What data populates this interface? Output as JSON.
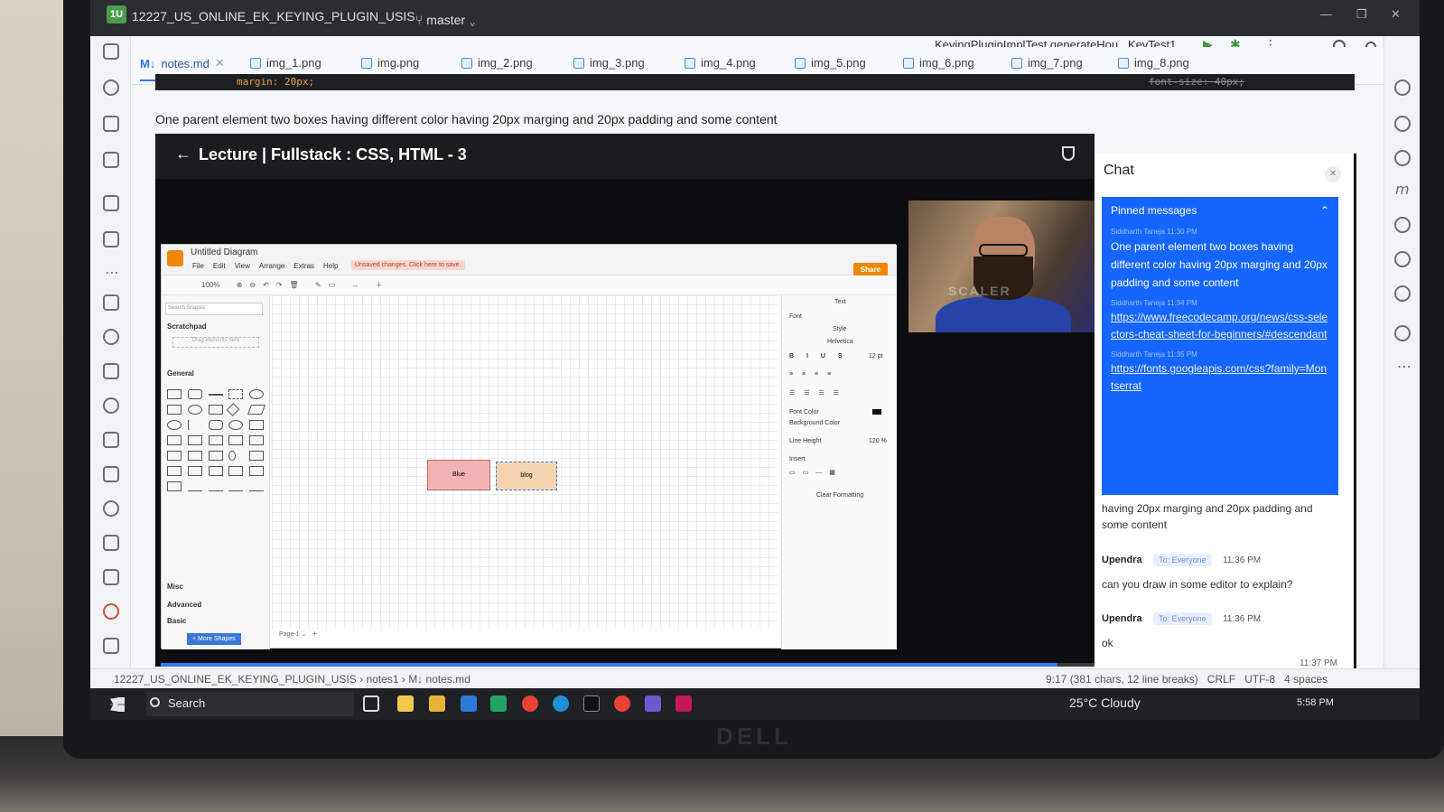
{
  "ide": {
    "project_badge": "1U",
    "project_name": "12227_US_ONLINE_EK_KEYING_PLUGIN_USIS",
    "branch": "master",
    "run_config": "KeyingPluginImplTest.generateHou...KeyTest1",
    "tabs": [
      {
        "label": "notes.md",
        "active": true,
        "prefix": "M↓"
      },
      {
        "label": "img_1.png"
      },
      {
        "label": "img.png"
      },
      {
        "label": "img_2.png"
      },
      {
        "label": "img_3.png"
      },
      {
        "label": "img_4.png"
      },
      {
        "label": "img_5.png"
      },
      {
        "label": "img_6.png"
      },
      {
        "label": "img_7.png"
      },
      {
        "label": "img_8.png"
      }
    ],
    "code_line": "margin: 20px;",
    "code_right": "font-size: 40px;",
    "notes_text": "One parent element two boxes having different color having 20px marging and 20px padding and some content",
    "status": {
      "path_root": "12227_US_ONLINE_EK_KEYING_PLUGIN_USIS",
      "path_folder": "notes1",
      "path_file": "M↓ notes.md",
      "position": "9:17 (381 chars, 12 line breaks)",
      "line_sep": "CRLF",
      "encoding": "UTF-8",
      "indent": "4 spaces"
    }
  },
  "lecture": {
    "title": "Lecture | Fullstack : CSS, HTML - 3",
    "progress": 0.96,
    "webcam_watermark": "SCALER"
  },
  "drawio": {
    "title": "Untitled Diagram",
    "menu": [
      "File",
      "Edit",
      "View",
      "Arrange",
      "Extras",
      "Help"
    ],
    "unsaved": "Unsaved changes. Click here to save.",
    "share": "Share",
    "zoom": "100%",
    "search_placeholder": "Search Shapes",
    "sections": [
      "Scratchpad",
      "General",
      "Misc",
      "Advanced",
      "Basic"
    ],
    "scratch_hint": "Drag elements here",
    "more_shapes": "+ More Shapes",
    "page": "Page-1",
    "box1": "Blue",
    "box2": "blog",
    "panel": {
      "tab": "Text",
      "font": "Font",
      "style": "Style",
      "font_name": "Helvetica",
      "font_size": "12 pt",
      "font_color": "Font Color",
      "bg_color": "Background Color",
      "line_height": "Line Height",
      "line_height_val": "120 %",
      "insert": "Insert",
      "clear": "Clear Formatting"
    }
  },
  "chat": {
    "title": "Chat",
    "pinned_header": "Pinned messages",
    "pinned": [
      {
        "meta": "Siddharth Taneja  11:30 PM",
        "text": "One parent element two boxes having different color having 20px marging and 20px padding and some content"
      },
      {
        "meta": "Siddharth Taneja  11:34 PM",
        "link": "https://www.freecodecamp.org/news/css-selectors-cheat-sheet-for-beginners/#descendant"
      },
      {
        "meta": "Siddharth Taneja  11:35 PM",
        "link": "https://fonts.googleapis.com/css?family=Montserrat"
      }
    ],
    "trail_text": "having 20px marging and 20px padding and some content",
    "messages": [
      {
        "name": "Upendra",
        "to": "To: Everyone",
        "time": "11:36 PM",
        "text": "can you draw in some editor to explain?"
      },
      {
        "name": "Upendra",
        "to": "To: Everyone",
        "time": "11:36 PM",
        "text": "ok"
      }
    ],
    "last_time": "11:37 PM"
  },
  "taskbar": {
    "search": "Search",
    "weather": "25°C  Cloudy",
    "clock": "5:58 PM"
  },
  "brand": "DELL"
}
